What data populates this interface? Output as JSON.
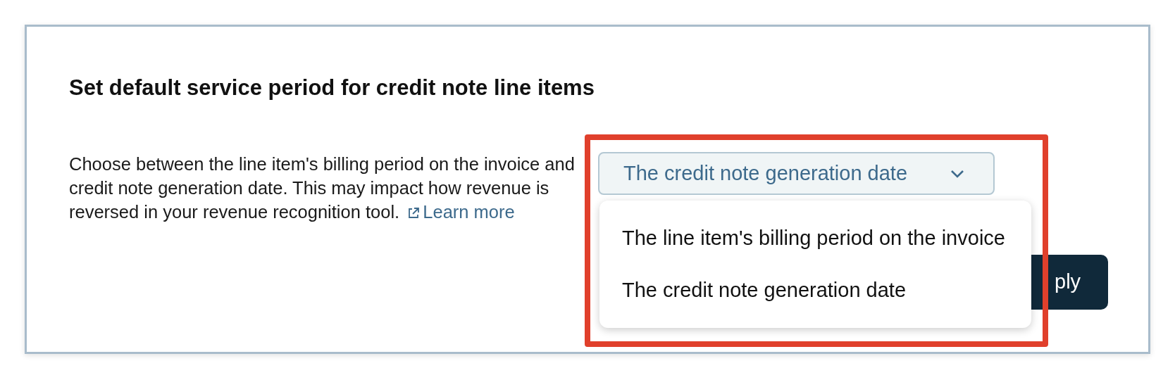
{
  "title": "Set default service period for credit note line items",
  "description": {
    "text": "Choose between the line item's billing period on the invoice and credit note generation date. This may impact how revenue is reversed in your revenue recognition tool.",
    "link": "Learn more"
  },
  "select": {
    "value": "The credit note generation date",
    "expanded": true
  },
  "options": [
    {
      "label": "The line item's billing period on the invoice"
    },
    {
      "label": "The credit note generation date"
    }
  ],
  "button": {
    "label": "ply"
  }
}
